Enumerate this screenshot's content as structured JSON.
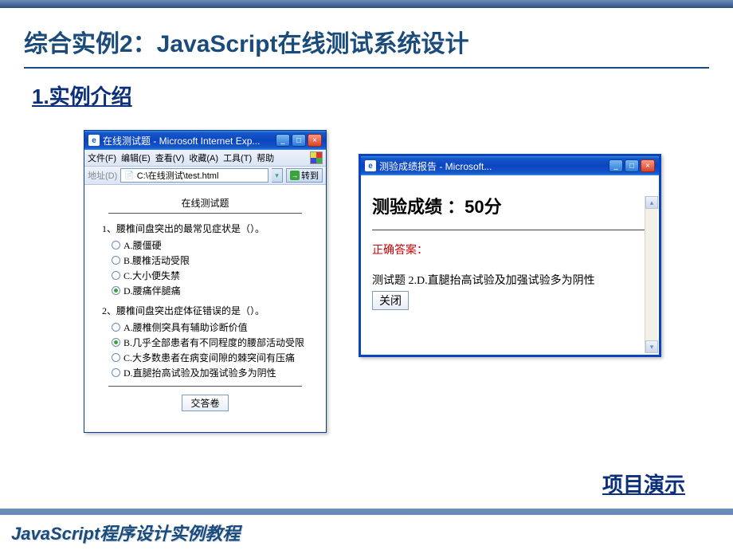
{
  "slide": {
    "title": "综合实例2：JavaScript在线测试系统设计",
    "section_heading": "1.实例介绍",
    "demo_link": "项目演示",
    "footer": "JavaScript程序设计实例教程"
  },
  "ie_window": {
    "title": "在线测试题 - Microsoft Internet Exp...",
    "menu": {
      "file": "文件(F)",
      "edit": "编辑(E)",
      "view": "查看(V)",
      "favorites": "收藏(A)",
      "tools": "工具(T)",
      "help": "帮助"
    },
    "address_label": "地址(D)",
    "address_value": "C:\\在线测试\\test.html",
    "go_label": "转到",
    "quiz": {
      "heading": "在线测试题",
      "q1": {
        "prompt": "1、腰椎间盘突出的最常见症状是（）。",
        "options": [
          "A.腰僵硬",
          "B.腰椎活动受限",
          "C.大小便失禁",
          "D.腰痛伴腿痛"
        ],
        "selected_index": 3
      },
      "q2": {
        "prompt": "2、腰椎间盘突出症体征错误的是（）。",
        "options": [
          "A.腰椎侧突具有辅助诊断价值",
          "B.几乎全部患者有不同程度的腰部活动受限",
          "C.大多数患者在病变间隙的棘突间有压痛",
          "D.直腿抬高试验及加强试验多为阴性"
        ],
        "selected_index": 1
      },
      "submit_label": "交答卷"
    }
  },
  "result_window": {
    "title": "测验成绩报告 - Microsoft...",
    "score_prefix": "测验成绩 ：",
    "score_value": "50分",
    "correct_label": "正确答案：",
    "answer_line": "测试题  2.D.直腿抬高试验及加强试验多为阴性",
    "close_label": "关闭"
  },
  "win_controls": {
    "min": "_",
    "max": "□",
    "close": "×"
  }
}
